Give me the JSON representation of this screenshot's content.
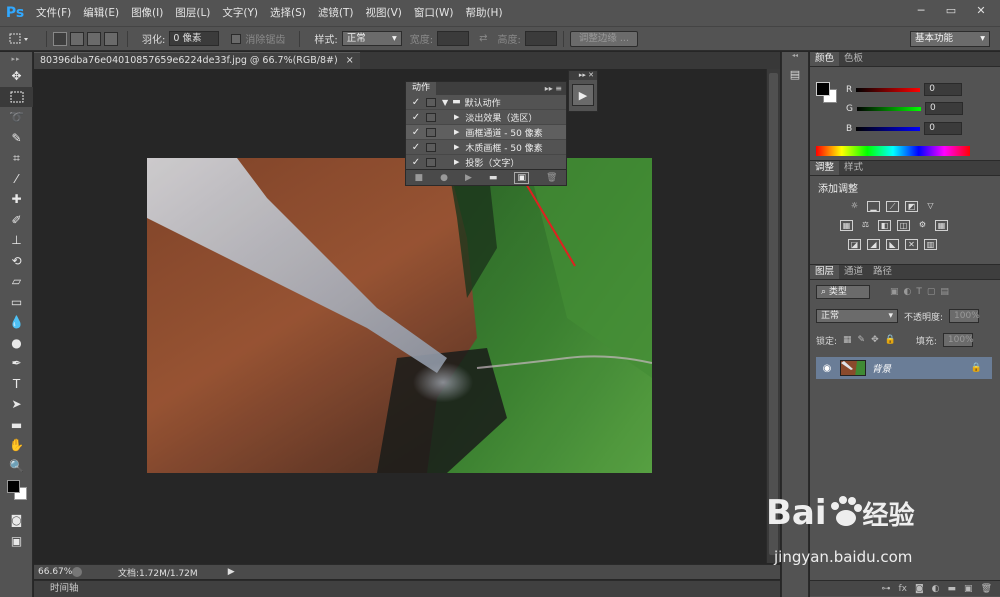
{
  "app": {
    "logo": "Ps",
    "accent": "#31a8ff"
  },
  "menu": [
    "文件(F)",
    "编辑(E)",
    "图像(I)",
    "图层(L)",
    "文字(Y)",
    "选择(S)",
    "滤镜(T)",
    "视图(V)",
    "窗口(W)",
    "帮助(H)"
  ],
  "window_controls": {
    "minimize": "─",
    "restore": "▭",
    "close": "✕"
  },
  "options": {
    "feather_label": "羽化:",
    "feather_value": "0 像素",
    "antialias_label": "消除锯齿",
    "style_label": "样式:",
    "style_value": "正常",
    "width_label": "宽度:",
    "height_label": "高度:",
    "refine_edge": "调整边缘 ...",
    "workspace": "基本功能"
  },
  "document": {
    "tab_title": "80396dba76e04010857659e6224de33f.jpg @ 66.7%(RGB/8#)",
    "tab_close": "×",
    "zoom": "66.67%",
    "doc_info": "文档:1.72M/1.72M"
  },
  "timeline": {
    "label": "时间轴"
  },
  "actions_panel": {
    "title": "动作",
    "set_name": "默认动作",
    "rows": [
      {
        "label": "淡出效果（选区）",
        "checked": "✓"
      },
      {
        "label": "画框通道 - 50 像素",
        "checked": "✓"
      },
      {
        "label": "木质画框 - 50 像素",
        "checked": "✓"
      },
      {
        "label": "投影（文字）",
        "checked": "✓"
      }
    ],
    "footer_icons": [
      "stop-icon",
      "record-icon",
      "play-icon",
      "folder-icon",
      "new-action-icon",
      "trash-icon"
    ]
  },
  "color_panel": {
    "tabs": [
      "颜色",
      "色板"
    ],
    "channels": [
      {
        "label": "R",
        "value": "0"
      },
      {
        "label": "G",
        "value": "0"
      },
      {
        "label": "B",
        "value": "0"
      }
    ]
  },
  "adjust_panel": {
    "tabs": [
      "调整",
      "样式"
    ],
    "title": "添加调整"
  },
  "layers_panel": {
    "tabs": [
      "图层",
      "通道",
      "路径"
    ],
    "filter": "类型",
    "blend_mode": "正常",
    "opacity_label": "不透明度:",
    "opacity_value": "100%",
    "lock_label": "锁定:",
    "fill_label": "填充:",
    "fill_value": "100%",
    "layer_name": "背景",
    "selected_color": "#6a7d97"
  },
  "watermark": {
    "brand_left": "Bai",
    "brand_right": "经验",
    "url": "jingyan.baidu.com"
  }
}
